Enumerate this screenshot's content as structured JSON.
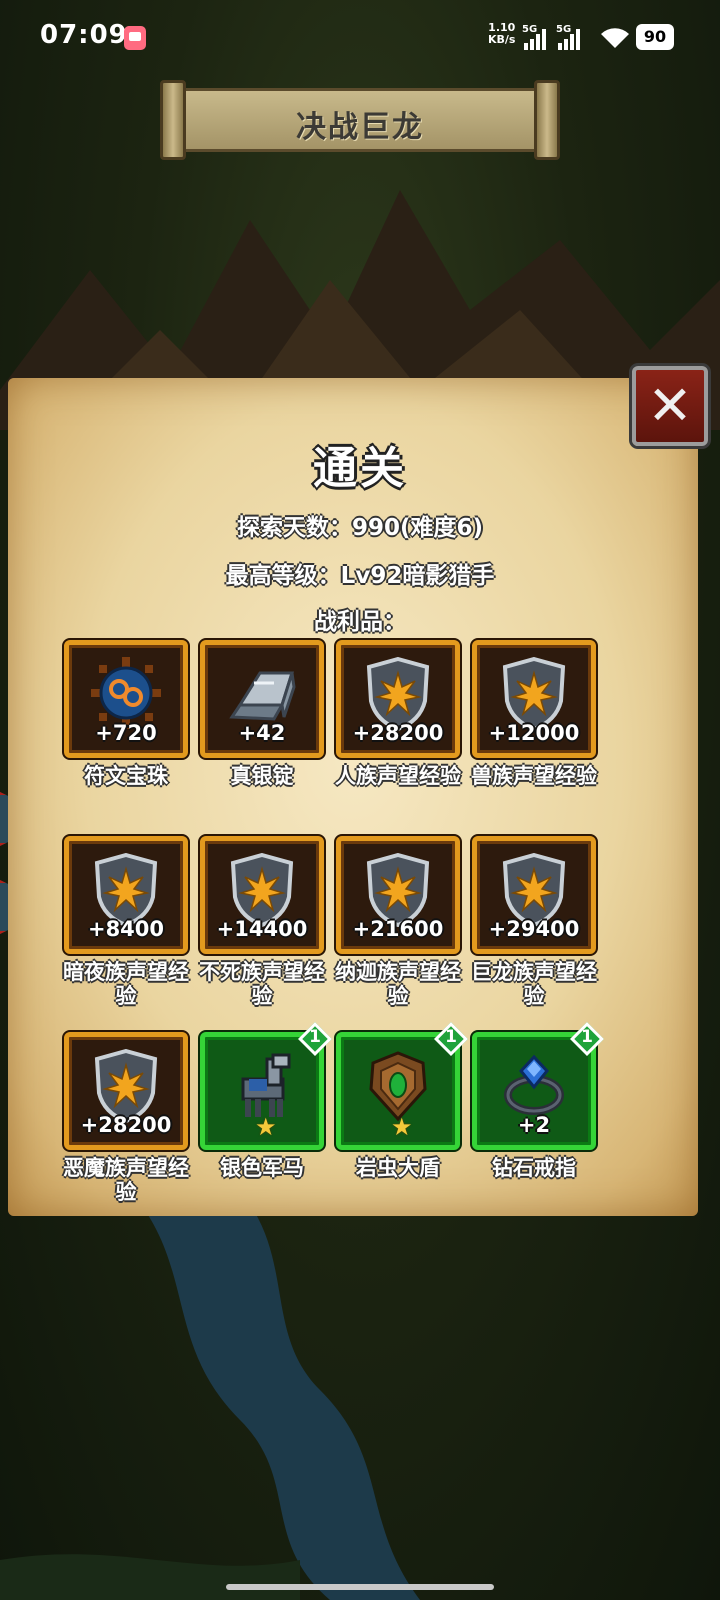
{
  "status_bar": {
    "time": "07:09",
    "net_speed_value": "1.10",
    "net_speed_unit": "KB/s",
    "sim1": "5G",
    "sim2": "5G",
    "battery": "90"
  },
  "banner": {
    "title": "决战巨龙"
  },
  "panel": {
    "title": "通关",
    "explore_days": "探索天数：990(难度6)",
    "max_level": "最高等级：Lv92暗影猎手",
    "loot_label": "战利品："
  },
  "close_button": {
    "icon": "close-icon",
    "glyph": "✕"
  },
  "items": [
    {
      "name": "符文宝珠",
      "amount": "+720",
      "style": "gold",
      "icon": "rune-orb-icon"
    },
    {
      "name": "真银锭",
      "amount": "+42",
      "style": "gold",
      "icon": "silver-ingot-icon"
    },
    {
      "name": "人族声望经验",
      "amount": "+28200",
      "style": "gold",
      "icon": "reputation-shield-icon"
    },
    {
      "name": "兽族声望经验",
      "amount": "+12000",
      "style": "gold",
      "icon": "reputation-shield-icon"
    },
    {
      "name": "暗夜族声望经验",
      "amount": "+8400",
      "style": "gold",
      "icon": "reputation-shield-icon"
    },
    {
      "name": "不死族声望经验",
      "amount": "+14400",
      "style": "gold",
      "icon": "reputation-shield-icon"
    },
    {
      "name": "纳迦族声望经验",
      "amount": "+21600",
      "style": "gold",
      "icon": "reputation-shield-icon"
    },
    {
      "name": "巨龙族声望经验",
      "amount": "+29400",
      "style": "gold",
      "icon": "reputation-shield-icon"
    },
    {
      "name": "恶魔族声望经验",
      "amount": "+28200",
      "style": "gold",
      "icon": "reputation-shield-icon"
    },
    {
      "name": "银色军马",
      "amount": "",
      "style": "green",
      "icon": "warhorse-icon",
      "badge": "1",
      "star": "★"
    },
    {
      "name": "岩虫大盾",
      "amount": "",
      "style": "green",
      "icon": "big-shield-icon",
      "badge": "1",
      "star": "★"
    },
    {
      "name": "钻石戒指",
      "amount": "+2",
      "style": "green",
      "icon": "diamond-ring-icon",
      "badge": "1"
    }
  ],
  "colors": {
    "gold_border": "#e39a1e",
    "green_border": "#35d437",
    "close_red": "#8a2317",
    "parchment": "#ead5a0"
  }
}
